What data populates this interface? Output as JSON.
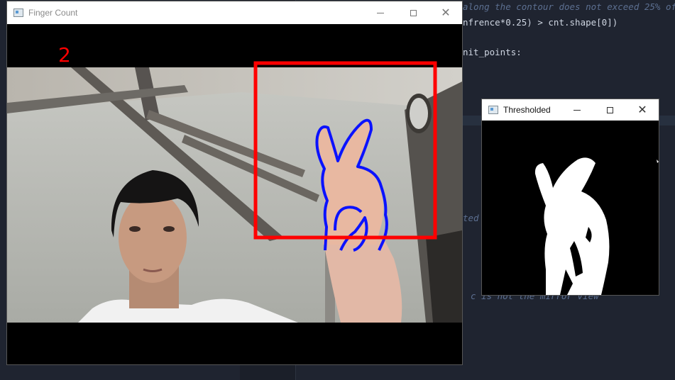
{
  "editor": {
    "lines": [
      {
        "text": "along the contour does not exceed 25% of t",
        "comment": true
      },
      {
        "text": "nfrence*0.25) > cnt.shape[0])",
        "comment": false
      },
      {
        "text": "nit_points:",
        "comment": false
      },
      {
        "text": "ted",
        "comment": true
      },
      {
        "text": "c is not the mirror view",
        "comment": true
      }
    ]
  },
  "finger_window": {
    "title": "Finger Count",
    "count": "2",
    "roi_color": "#ff0000",
    "contour_color": "#0b12ff"
  },
  "threshold_window": {
    "title": "Thresholded"
  },
  "icons": {
    "app": "opencv-window-icon",
    "minimize": "minimize-icon",
    "maximize": "maximize-icon",
    "close": "close-icon"
  }
}
